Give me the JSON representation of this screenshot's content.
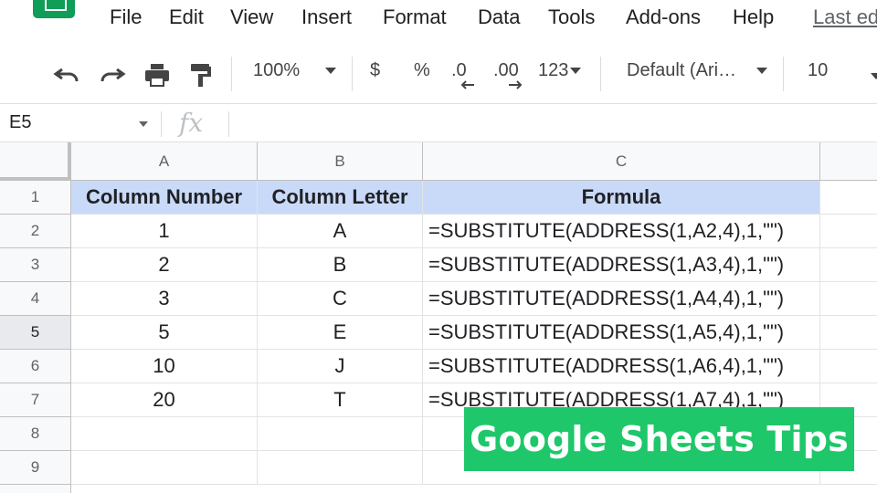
{
  "menu": {
    "items": [
      "File",
      "Edit",
      "View",
      "Insert",
      "Format",
      "Data",
      "Tools",
      "Add-ons",
      "Help"
    ],
    "last_edit": "Last ed"
  },
  "toolbar": {
    "zoom": "100%",
    "currency": "$",
    "percent": "%",
    "decrease_decimal": ".0",
    "increase_decimal": ".00",
    "more_formats": "123",
    "font": "Default (Ari…",
    "font_size": "10",
    "icons": [
      "undo-icon",
      "redo-icon",
      "print-icon",
      "paint-format-icon"
    ]
  },
  "formula_bar": {
    "cell_ref": "E5",
    "fx": "fx",
    "value": ""
  },
  "grid": {
    "columns": [
      "A",
      "B",
      "C"
    ],
    "rows": [
      "1",
      "2",
      "3",
      "4",
      "5",
      "6",
      "7",
      "8",
      "9"
    ],
    "selected_row": "5",
    "header": [
      "Column Number",
      "Column Letter",
      "Formula"
    ],
    "data": [
      [
        "1",
        "A",
        "=SUBSTITUTE(ADDRESS(1,A2,4),1,\"\")"
      ],
      [
        "2",
        "B",
        "=SUBSTITUTE(ADDRESS(1,A3,4),1,\"\")"
      ],
      [
        "3",
        "C",
        "=SUBSTITUTE(ADDRESS(1,A4,4),1,\"\")"
      ],
      [
        "5",
        "E",
        "=SUBSTITUTE(ADDRESS(1,A5,4),1,\"\")"
      ],
      [
        "10",
        "J",
        "=SUBSTITUTE(ADDRESS(1,A6,4),1,\"\")"
      ],
      [
        "20",
        "T",
        "=SUBSTITUTE(ADDRESS(1,A7,4),1,\"\")"
      ]
    ]
  },
  "banner": {
    "text": "Google Sheets Tips",
    "color": "#1ec769"
  },
  "colors": {
    "header_fill": "#c9daf8",
    "logo": "#0f9d58"
  }
}
